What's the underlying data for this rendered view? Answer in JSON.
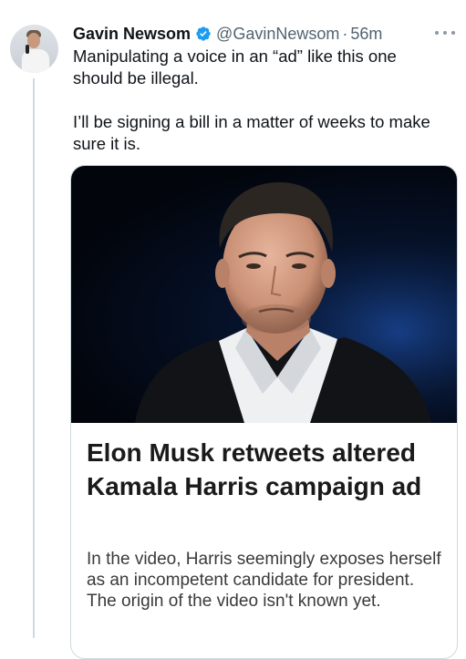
{
  "author": {
    "name": "Gavin Newsom",
    "handle": "@GavinNewsom",
    "separator": "·",
    "time": "56m",
    "verified_icon": "verified-badge-icon",
    "verified_color": "#1d9bf0"
  },
  "tweet": {
    "paragraphs": [
      "Manipulating a voice in an “ad” like this one should be illegal.",
      "I’ll be signing a bill in a matter of weeks to make sure it is."
    ]
  },
  "card": {
    "image_icon": "news-photo",
    "title": "Elon Musk retweets altered Kamala Harris campaign ad",
    "description": "In the video, Harris seemingly exposes herself as an incompetent candidate for president. The origin of the video isn't known yet."
  },
  "colors": {
    "text_primary": "#0f1419",
    "text_secondary": "#536471",
    "border": "#cfd9de"
  }
}
